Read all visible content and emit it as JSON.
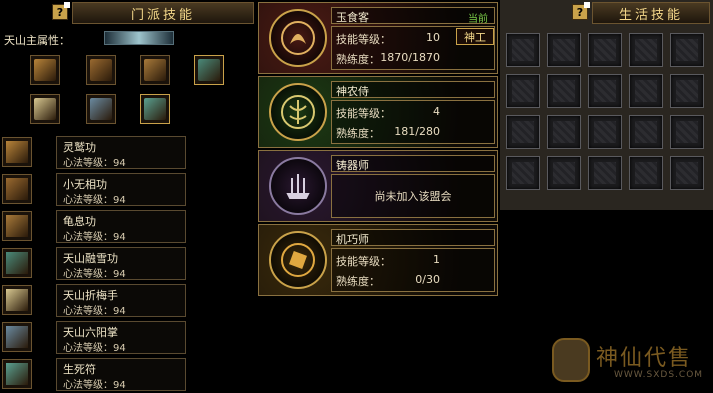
{
  "left_panel": {
    "help_label": "?",
    "title": "门派技能",
    "main_attr_label": "天山主属性："
  },
  "attr_icons": [
    {
      "icon": "bamboo-scroll-icon",
      "color": "#b8843a"
    },
    {
      "icon": "book-stack-icon",
      "color": "#9a6a30"
    },
    {
      "icon": "tome-icon",
      "color": "#a87a3a"
    },
    {
      "icon": "jade-book-icon",
      "color": "#4a8a7a"
    },
    {
      "icon": "talisman-icon",
      "color": "#d8c890"
    },
    {
      "icon": "tome-icon",
      "color": "#6a8aa0"
    },
    {
      "icon": "rune-icon",
      "color": "#5aa090"
    }
  ],
  "skills": [
    {
      "name": "灵鹫功",
      "level": "心法等级：94",
      "color": "#b8843a"
    },
    {
      "name": "小无相功",
      "level": "心法等级：94",
      "color": "#9a6a30"
    },
    {
      "name": "龟息功",
      "level": "心法等级：94",
      "color": "#a87a3a"
    },
    {
      "name": "天山融雪功",
      "level": "心法等级：94",
      "color": "#4a8a7a"
    },
    {
      "name": "天山折梅手",
      "level": "心法等级：94",
      "color": "#d8c890"
    },
    {
      "name": "天山六阳掌",
      "level": "心法等级：94",
      "color": "#6a8aa0"
    },
    {
      "name": "生死符",
      "level": "心法等级：94",
      "color": "#5aa090"
    }
  ],
  "cards": {
    "yushike": {
      "title": "玉食客",
      "current": "当前",
      "skill_label": "技能等级：",
      "skill_value": "10",
      "prof_label": "熟练度：",
      "prof_value": "1870/1870",
      "button": "神工",
      "bg": "#4a1a14"
    },
    "shennong": {
      "title": "神农侍",
      "skill_label": "技能等级：",
      "skill_value": "4",
      "prof_label": "熟练度：",
      "prof_value": "181/280",
      "bg": "#1c3a14"
    },
    "zhuqi": {
      "title": "铸器师",
      "status": "尚未加入该盟会",
      "bg": "#2a1830"
    },
    "jiqiao": {
      "title": "机巧师",
      "skill_label": "技能等级：",
      "skill_value": "1",
      "prof_label": "熟练度：",
      "prof_value": "0/30",
      "bg": "#3a2a0c"
    }
  },
  "right_panel": {
    "help_label": "?",
    "title": "生活技能",
    "slot_count": 20
  },
  "watermark": {
    "text": "神仙代售",
    "site": "WWW.SXDS.COM"
  }
}
